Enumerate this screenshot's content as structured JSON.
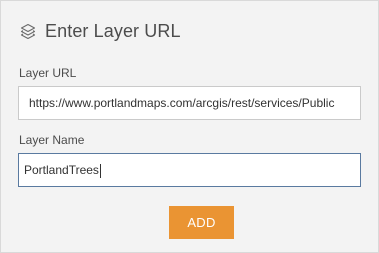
{
  "header": {
    "icon": "layers-icon",
    "title": "Enter Layer URL"
  },
  "layer_url": {
    "label": "Layer URL",
    "value": "https://www.portlandmaps.com/arcgis/rest/services/Public"
  },
  "layer_name": {
    "label": "Layer Name",
    "value": "PortlandTrees"
  },
  "actions": {
    "add_label": "ADD"
  },
  "colors": {
    "panel_bg": "#f3f3f3",
    "accent": "#ea9433",
    "focus_border": "#5a7aa0"
  }
}
